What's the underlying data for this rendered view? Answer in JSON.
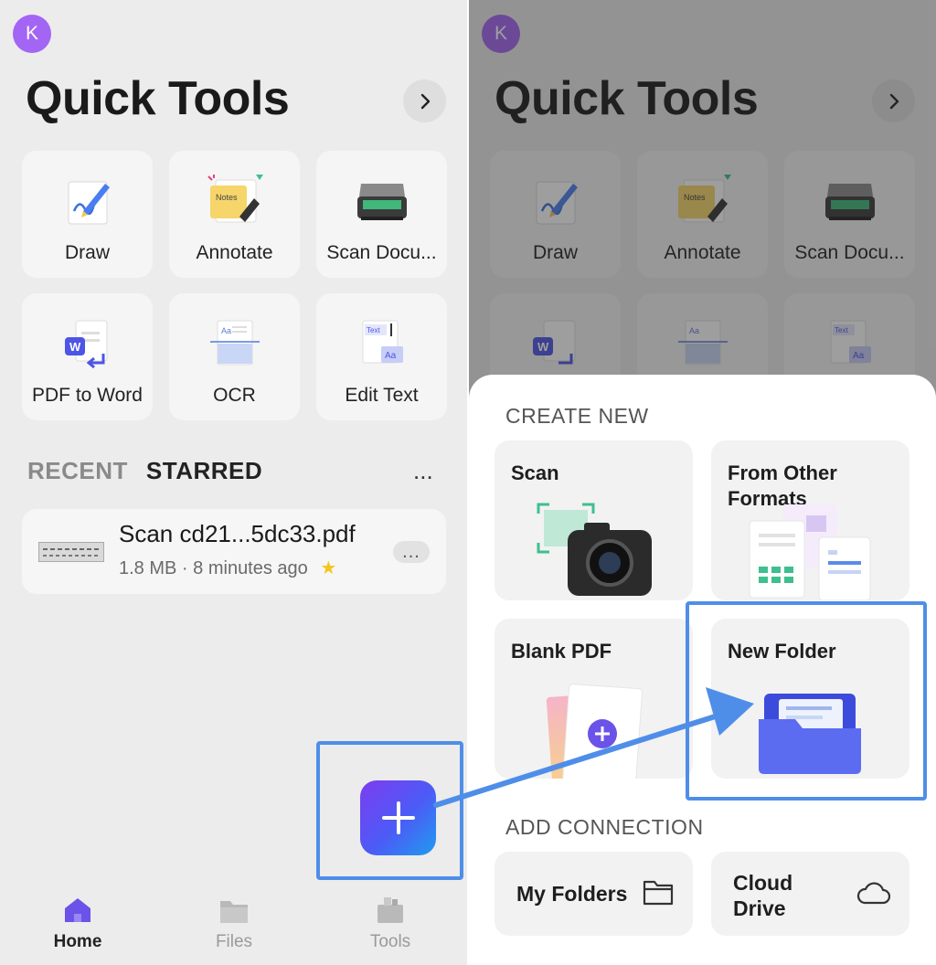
{
  "left": {
    "avatar_letter": "K",
    "title": "Quick Tools",
    "tools": [
      {
        "label": "Draw",
        "icon": "draw-icon"
      },
      {
        "label": "Annotate",
        "icon": "annotate-icon"
      },
      {
        "label": "Scan Docu...",
        "icon": "scanner-icon"
      },
      {
        "label": "PDF to Word",
        "icon": "pdf-to-word-icon"
      },
      {
        "label": "OCR",
        "icon": "ocr-icon"
      },
      {
        "label": "Edit Text",
        "icon": "edit-text-icon"
      }
    ],
    "tabs": {
      "recent": "RECENT",
      "starred": "STARRED"
    },
    "more": "...",
    "recent_file": {
      "name": "Scan cd21...5dc33.pdf",
      "size": "1.8 MB",
      "separator": "·",
      "time": "8 minutes ago",
      "more": "..."
    },
    "nav": [
      {
        "label": "Home",
        "icon": "home-icon",
        "active": true
      },
      {
        "label": "Files",
        "icon": "folder-icon",
        "active": false
      },
      {
        "label": "Tools",
        "icon": "toolbox-icon",
        "active": false
      }
    ]
  },
  "right": {
    "avatar_letter": "K",
    "title": "Quick Tools",
    "tools": [
      {
        "label": "Draw",
        "icon": "draw-icon"
      },
      {
        "label": "Annotate",
        "icon": "annotate-icon"
      },
      {
        "label": "Scan Docu...",
        "icon": "scanner-icon"
      },
      {
        "label": "",
        "icon": "pdf-to-word-icon"
      },
      {
        "label": "",
        "icon": "ocr-icon"
      },
      {
        "label": "",
        "icon": "edit-text-icon"
      }
    ],
    "sheet": {
      "create_new": "CREATE NEW",
      "cards": [
        {
          "label": "Scan",
          "icon": "camera-icon"
        },
        {
          "label_line1": "From Other",
          "label_line2": "Formats",
          "icon": "documents-icon"
        },
        {
          "label": "Blank PDF",
          "icon": "blank-pdf-icon"
        },
        {
          "label": "New Folder",
          "icon": "new-folder-icon"
        }
      ],
      "add_connection": "ADD CONNECTION",
      "connections": [
        {
          "label": "My Folders",
          "icon": "folder-outline-icon"
        },
        {
          "label_line1": "Cloud",
          "label_line2": "Drive",
          "icon": "cloud-icon"
        }
      ]
    }
  },
  "colors": {
    "avatar": "#a365f3",
    "accent": "#5b4ff0",
    "highlight": "#4f8ee8",
    "star": "#f5c518"
  }
}
